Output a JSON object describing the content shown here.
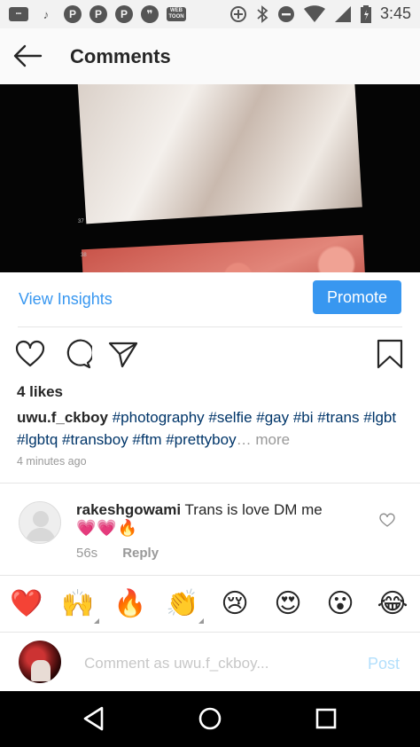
{
  "status_bar": {
    "time": "3:45",
    "left_icons": [
      "more-icon",
      "tiktok-icon",
      "pinterest-icon",
      "pinterest-icon",
      "pinterest-icon",
      "quote-icon",
      "webtoon-icon"
    ],
    "webtoon_label": "WEB TOON",
    "right_icons": [
      "add-circle-icon",
      "bluetooth-icon",
      "do-not-disturb-icon",
      "wifi-icon",
      "signal-icon",
      "battery-icon"
    ]
  },
  "header": {
    "title": "Comments"
  },
  "photo": {
    "frame_numbers": [
      "37",
      "38"
    ]
  },
  "insights": {
    "view_label": "View Insights",
    "promote_label": "Promote"
  },
  "post": {
    "likes": "4 likes",
    "username": "uwu.f_ckboy",
    "caption_tags": "#photography #selfie #gay #bi #trans #lgbt #lgbtq #transboy #ftm #prettyboy",
    "ellipsis": "…",
    "more_label": "more",
    "time_ago": "4 minutes ago"
  },
  "comment": {
    "username": "rakeshgowami",
    "text": "Trans is love DM me",
    "emojis": "💗💗",
    "fire": "🔥",
    "age": "56s",
    "reply_label": "Reply"
  },
  "quick_emojis": [
    "❤️",
    "🙌",
    "🔥",
    "👏",
    "😢",
    "😍",
    "😮",
    "😂"
  ],
  "compose": {
    "placeholder": "Comment as uwu.f_ckboy...",
    "post_label": "Post"
  },
  "colors": {
    "accent": "#3897f0",
    "post_disabled": "#b2dffc",
    "hashtag": "#003569"
  }
}
